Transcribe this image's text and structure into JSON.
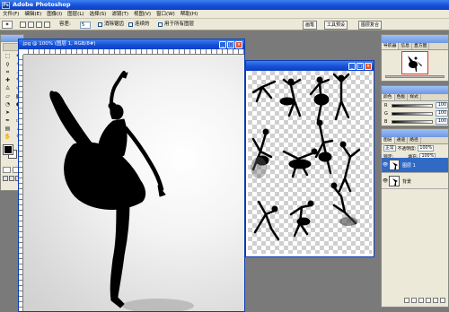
{
  "app": {
    "title": "Adobe Photoshop",
    "icon_text": "Ps"
  },
  "menu": [
    "文件(F)",
    "编辑(E)",
    "图像(I)",
    "图层(L)",
    "选择(S)",
    "滤镜(T)",
    "视图(V)",
    "窗口(W)",
    "帮助(H)"
  ],
  "options": {
    "tool_icon": "magic-wand",
    "tolerance_label": "容差:",
    "tolerance_value": "5",
    "antialias_label": "消除锯齿",
    "contiguous_label": "连续的",
    "all_layers_label": "用于所有图层"
  },
  "palette_wells": [
    "画笔",
    "工具预设",
    "图层复合"
  ],
  "document": {
    "title": ".jpg @ 100% (图层 1, RGB/8#)"
  },
  "navigator": {
    "tabs": [
      "导航器",
      "信息",
      "直方图"
    ]
  },
  "color_panel": {
    "tabs": [
      "颜色",
      "色板",
      "样式"
    ],
    "channels": [
      {
        "label": "R",
        "value": "100"
      },
      {
        "label": "G",
        "value": "100"
      },
      {
        "label": "B",
        "value": "100"
      }
    ]
  },
  "layers_panel": {
    "tabs": [
      "图层",
      "通道",
      "路径"
    ],
    "blend_mode": "正常",
    "opacity_label": "不透明度:",
    "opacity_value": "100%",
    "lock_label": "锁定:",
    "fill_label": "填充:",
    "fill_value": "100%",
    "layers": [
      {
        "name": "图层 1",
        "selected": true
      },
      {
        "name": "背景",
        "selected": false
      }
    ]
  },
  "colors": {
    "xp_blue": "#1750d8",
    "panel_bg": "#ece9d8",
    "workspace": "#7a7a7a",
    "selection": "#316ac5",
    "silhouette": "#000000"
  }
}
